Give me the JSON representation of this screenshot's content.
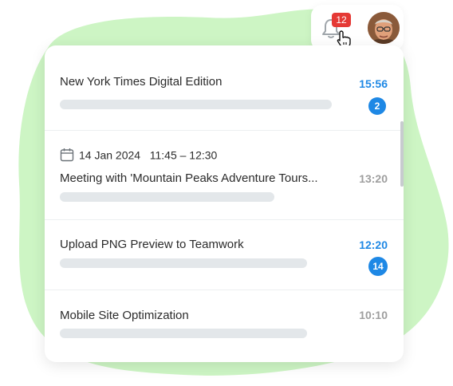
{
  "notifications_badge": "12",
  "items": [
    {
      "title": "New York Times Digital Edition",
      "time": "15:56",
      "unread": "2"
    },
    {
      "date": "14 Jan 2024",
      "time_range": "11:45 – 12:30",
      "title": "Meeting with 'Mountain Peaks Adventure Tours...",
      "time": "13:20"
    },
    {
      "title": "Upload PNG Preview to Teamwork",
      "time": "12:20",
      "unread": "14"
    },
    {
      "title": "Mobile Site Optimization",
      "time": "10:10"
    }
  ],
  "icons": {
    "bell": "bell-icon",
    "cursor": "hand-pointer-icon",
    "calendar": "calendar-icon",
    "avatar": "user-avatar"
  },
  "colors": {
    "accent": "#1e88e5",
    "badge": "#e53935",
    "blob": "#cdf5c4",
    "skeleton": "#e3e7ea"
  }
}
